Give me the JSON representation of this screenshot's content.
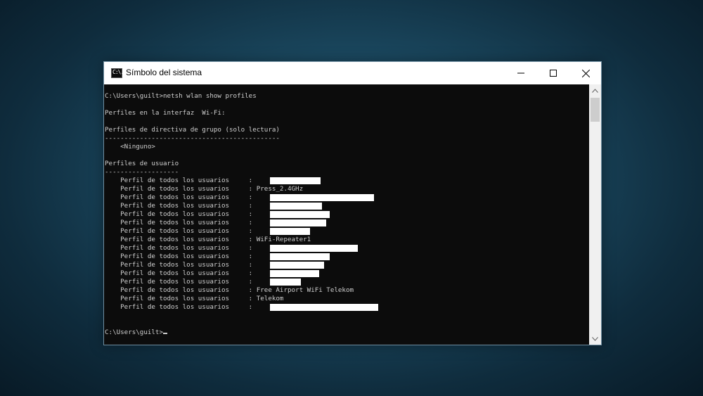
{
  "window": {
    "title": "Símbolo del sistema",
    "icon_text": "C:\\."
  },
  "console": {
    "lines": [
      "C:\\Users\\guilt>netsh wlan show profiles",
      "",
      "Perfiles en la interfaz  Wi-Fi:",
      "",
      "Perfiles de directiva de grupo (solo lectura)",
      "---------------------------------------------",
      "    <Ninguno>",
      "",
      "Perfiles de usuario",
      "-------------------",
      "    Perfil de todos los usuarios     : ",
      "    Perfil de todos los usuarios     : Press_2.4GHz",
      "    Perfil de todos los usuarios     : ",
      "    Perfil de todos los usuarios     : ",
      "    Perfil de todos los usuarios     : ",
      "    Perfil de todos los usuarios     : ",
      "    Perfil de todos los usuarios     : ",
      "    Perfil de todos los usuarios     : WiFi-Repeater1",
      "    Perfil de todos los usuarios     : ",
      "    Perfil de todos los usuarios     : ",
      "    Perfil de todos los usuarios     : ",
      "    Perfil de todos los usuarios     : ",
      "    Perfil de todos los usuarios     : ",
      "    Perfil de todos los usuarios     : Free Airport WiFi Telekom",
      "    Perfil de todos los usuarios     : Telekom",
      "    Perfil de todos los usuarios     : ",
      "",
      "",
      "C:\\Users\\guilt>"
    ]
  },
  "colors": {
    "console_bg": "#0c0c0c",
    "console_text": "#cfcfcf",
    "redaction": "#ffffff"
  },
  "icons": [
    "cmd-app-icon",
    "minimize-icon",
    "maximize-icon",
    "close-icon",
    "scroll-up-icon",
    "scroll-down-icon"
  ]
}
